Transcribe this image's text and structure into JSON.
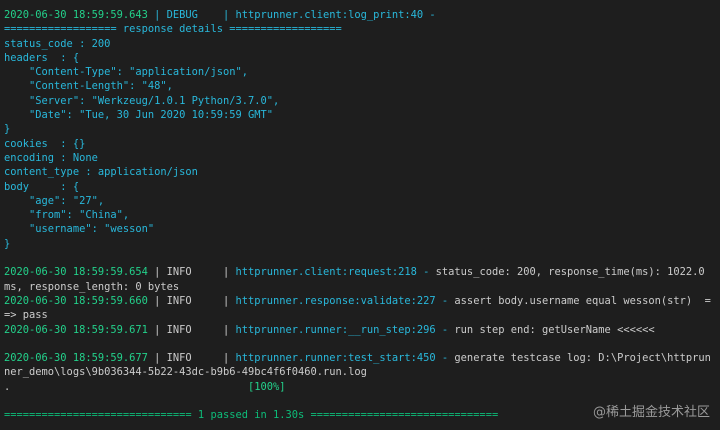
{
  "theme": {
    "background": "#1e1e1e",
    "green": "#23d18b",
    "cyan": "#29b8db",
    "white": "#cccccc"
  },
  "lines": [
    {
      "name": "log-line",
      "segments": [
        {
          "t": "2020-06-30 18:59:59.643 ",
          "c": "g"
        },
        {
          "t": "| DEBUG    | ",
          "c": "c"
        },
        {
          "t": "httprunner.client:log_print:40 -",
          "c": "c"
        }
      ]
    },
    {
      "name": "response-details-header",
      "segments": [
        {
          "t": "================== response details ==================",
          "c": "c"
        }
      ]
    },
    {
      "name": "status-code",
      "segments": [
        {
          "t": "status_code : 200",
          "c": "c"
        }
      ]
    },
    {
      "name": "headers-open",
      "segments": [
        {
          "t": "headers  : {",
          "c": "c"
        }
      ]
    },
    {
      "name": "header-content-type",
      "segments": [
        {
          "t": "    \"Content-Type\": \"application/json\",",
          "c": "c"
        }
      ]
    },
    {
      "name": "header-content-length",
      "segments": [
        {
          "t": "    \"Content-Length\": \"48\",",
          "c": "c"
        }
      ]
    },
    {
      "name": "header-server",
      "segments": [
        {
          "t": "    \"Server\": \"Werkzeug/1.0.1 Python/3.7.0\",",
          "c": "c"
        }
      ]
    },
    {
      "name": "header-date",
      "segments": [
        {
          "t": "    \"Date\": \"Tue, 30 Jun 2020 10:59:59 GMT\"",
          "c": "c"
        }
      ]
    },
    {
      "name": "headers-close",
      "segments": [
        {
          "t": "}",
          "c": "c"
        }
      ]
    },
    {
      "name": "cookies",
      "segments": [
        {
          "t": "cookies  : {}",
          "c": "c"
        }
      ]
    },
    {
      "name": "encoding",
      "segments": [
        {
          "t": "encoding : None",
          "c": "c"
        }
      ]
    },
    {
      "name": "content-type",
      "segments": [
        {
          "t": "content_type : application/json",
          "c": "c"
        }
      ]
    },
    {
      "name": "body-open",
      "segments": [
        {
          "t": "body     : {",
          "c": "c"
        }
      ]
    },
    {
      "name": "body-age",
      "segments": [
        {
          "t": "    \"age\": \"27\",",
          "c": "c"
        }
      ]
    },
    {
      "name": "body-from",
      "segments": [
        {
          "t": "    \"from\": \"China\",",
          "c": "c"
        }
      ]
    },
    {
      "name": "body-username",
      "segments": [
        {
          "t": "    \"username\": \"wesson\"",
          "c": "c"
        }
      ]
    },
    {
      "name": "body-close",
      "segments": [
        {
          "t": "}",
          "c": "c"
        }
      ]
    },
    {
      "name": "blank-line",
      "segments": [
        {
          "t": " ",
          "c": "w"
        }
      ]
    },
    {
      "name": "log-line",
      "segments": [
        {
          "t": "2020-06-30 18:59:59.654 ",
          "c": "g"
        },
        {
          "t": "| INFO     | ",
          "c": "w"
        },
        {
          "t": "httprunner.client:request:218 - ",
          "c": "c"
        },
        {
          "t": "status_code: 200, response_time(ms): 1022.0",
          "c": "w"
        }
      ]
    },
    {
      "name": "log-line-wrap",
      "segments": [
        {
          "t": "ms, response_length: 0 bytes",
          "c": "w"
        }
      ]
    },
    {
      "name": "log-line",
      "segments": [
        {
          "t": "2020-06-30 18:59:59.660 ",
          "c": "g"
        },
        {
          "t": "| INFO     | ",
          "c": "w"
        },
        {
          "t": "httprunner.response:validate:227 - ",
          "c": "c"
        },
        {
          "t": "assert body.username equal wesson(str)  =",
          "c": "w"
        }
      ]
    },
    {
      "name": "log-line-wrap",
      "segments": [
        {
          "t": "=> pass",
          "c": "w"
        }
      ]
    },
    {
      "name": "log-line",
      "segments": [
        {
          "t": "2020-06-30 18:59:59.671 ",
          "c": "g"
        },
        {
          "t": "| INFO     | ",
          "c": "w"
        },
        {
          "t": "httprunner.runner:__run_step:296 - ",
          "c": "c"
        },
        {
          "t": "run step end: getUserName <<<<<<",
          "c": "w"
        }
      ]
    },
    {
      "name": "blank-line",
      "segments": [
        {
          "t": " ",
          "c": "w"
        }
      ]
    },
    {
      "name": "log-line",
      "segments": [
        {
          "t": "2020-06-30 18:59:59.677 ",
          "c": "g"
        },
        {
          "t": "| INFO     | ",
          "c": "w"
        },
        {
          "t": "httprunner.runner:test_start:450 - ",
          "c": "c"
        },
        {
          "t": "generate testcase log: D:\\Project\\httprun",
          "c": "w"
        }
      ]
    },
    {
      "name": "log-line-wrap",
      "segments": [
        {
          "t": "ner_demo\\logs\\9b036344-5b22-43dc-b9b6-49bc4f6f0460.run.log",
          "c": "w"
        }
      ]
    },
    {
      "name": "progress-line",
      "segments": [
        {
          "t": ".",
          "c": "w"
        },
        {
          "t": "                                      [100%]",
          "c": "g"
        }
      ]
    },
    {
      "name": "blank-line",
      "segments": [
        {
          "t": " ",
          "c": "w"
        }
      ]
    },
    {
      "name": "summary-line",
      "segments": [
        {
          "t": "============================== 1 passed in 1.30s ==============================",
          "c": "gb"
        }
      ]
    }
  ],
  "watermark": "@稀土掘金技术社区"
}
